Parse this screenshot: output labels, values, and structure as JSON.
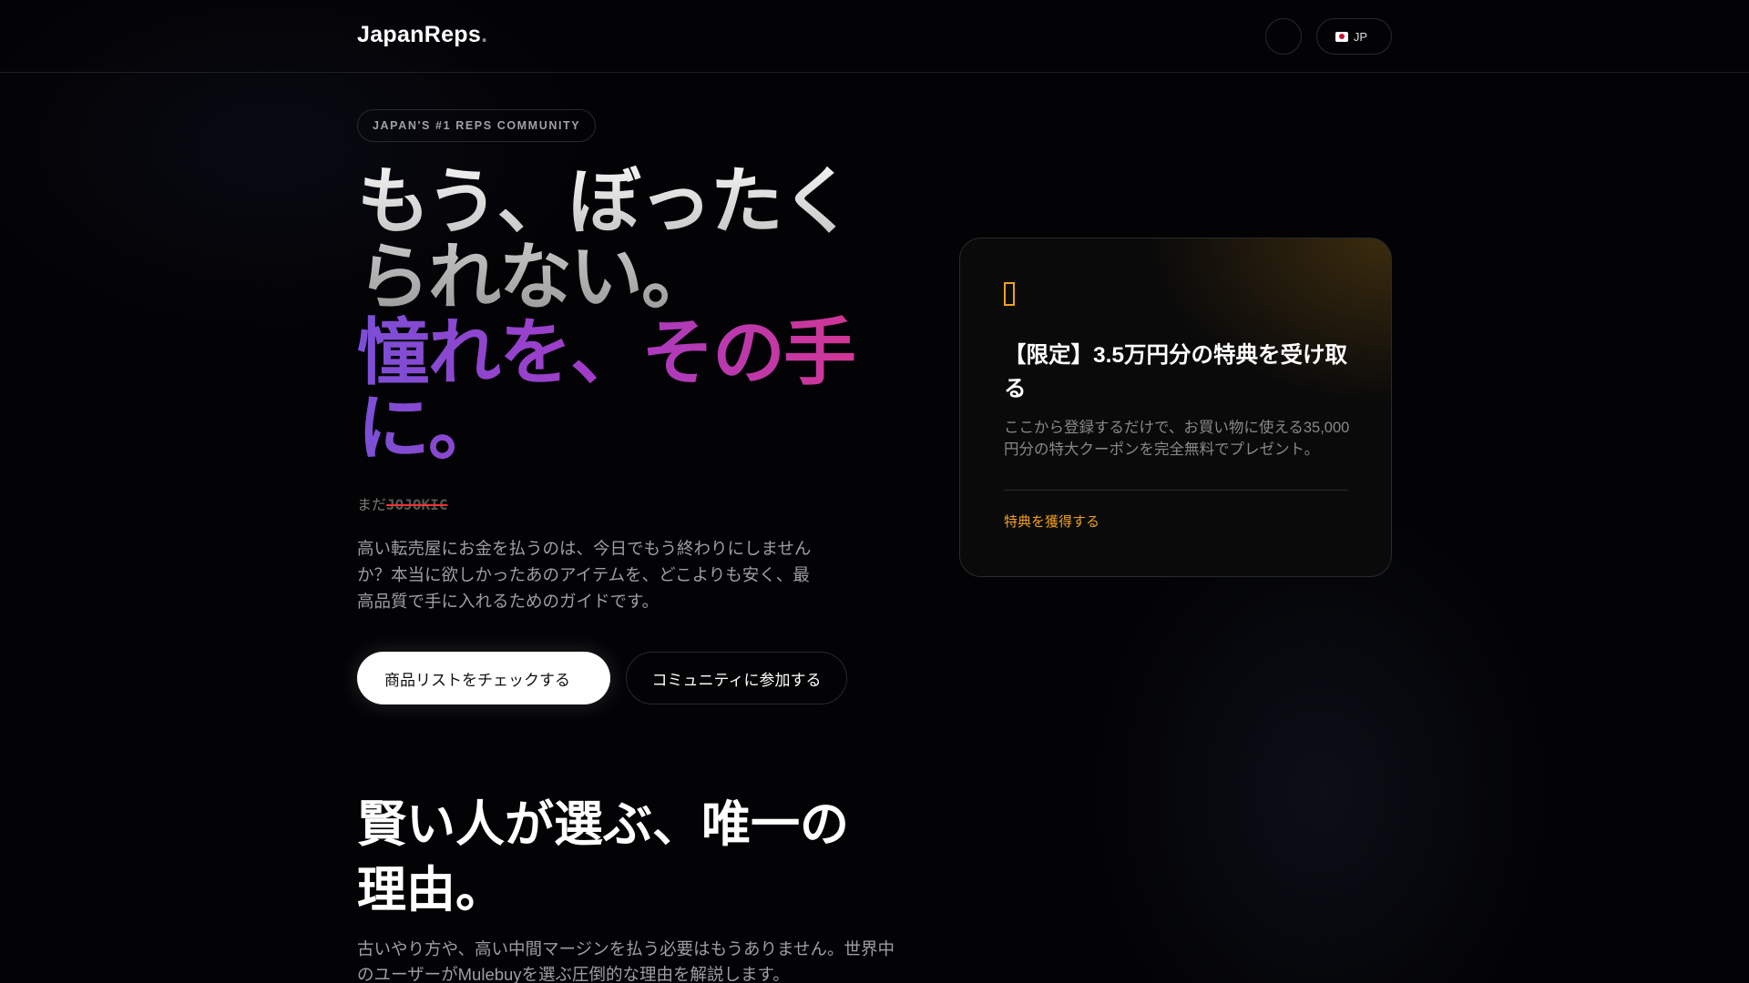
{
  "header": {
    "logo": "JapanReps",
    "logo_dot": ".",
    "icon_button": "",
    "lang_label": "JP",
    "lang_chevron": ""
  },
  "hero": {
    "badge": "JAPAN'S #1 REPS COMMUNITY",
    "headline_line1": "もう、ぼったくられない。",
    "headline_line2": "憧れを、その手に。",
    "still_prefix": "まだ",
    "still_struck": "JOJOKIC",
    "lead": "高い転売屋にお金を払うのは、今日でもう終わりにしませんか？本当に欲しかったあのアイテムを、どこよりも安く、最高品質で手に入れるためのガイドです。",
    "primary_button": "商品リストをチェックする",
    "primary_arrow": "",
    "secondary_button": "コミュニティに参加する"
  },
  "promo_card": {
    "icon": "",
    "title": "【限定】3.5万円分の特典を受け取る",
    "description": "ここから登録するだけで、お買い物に使える35,000円分の特大クーポンを完全無料でプレゼント。",
    "link": "特典を獲得する",
    "link_arrow": "",
    "accent": "#f0a020"
  },
  "why": {
    "title": "賢い人が選ぶ、唯一の理由。",
    "lead": "古いやり方や、高い中間マージンを払う必要はもうありません。世界中のユーザーがMulebuyを選ぶ圧倒的な理由を解説します。"
  }
}
